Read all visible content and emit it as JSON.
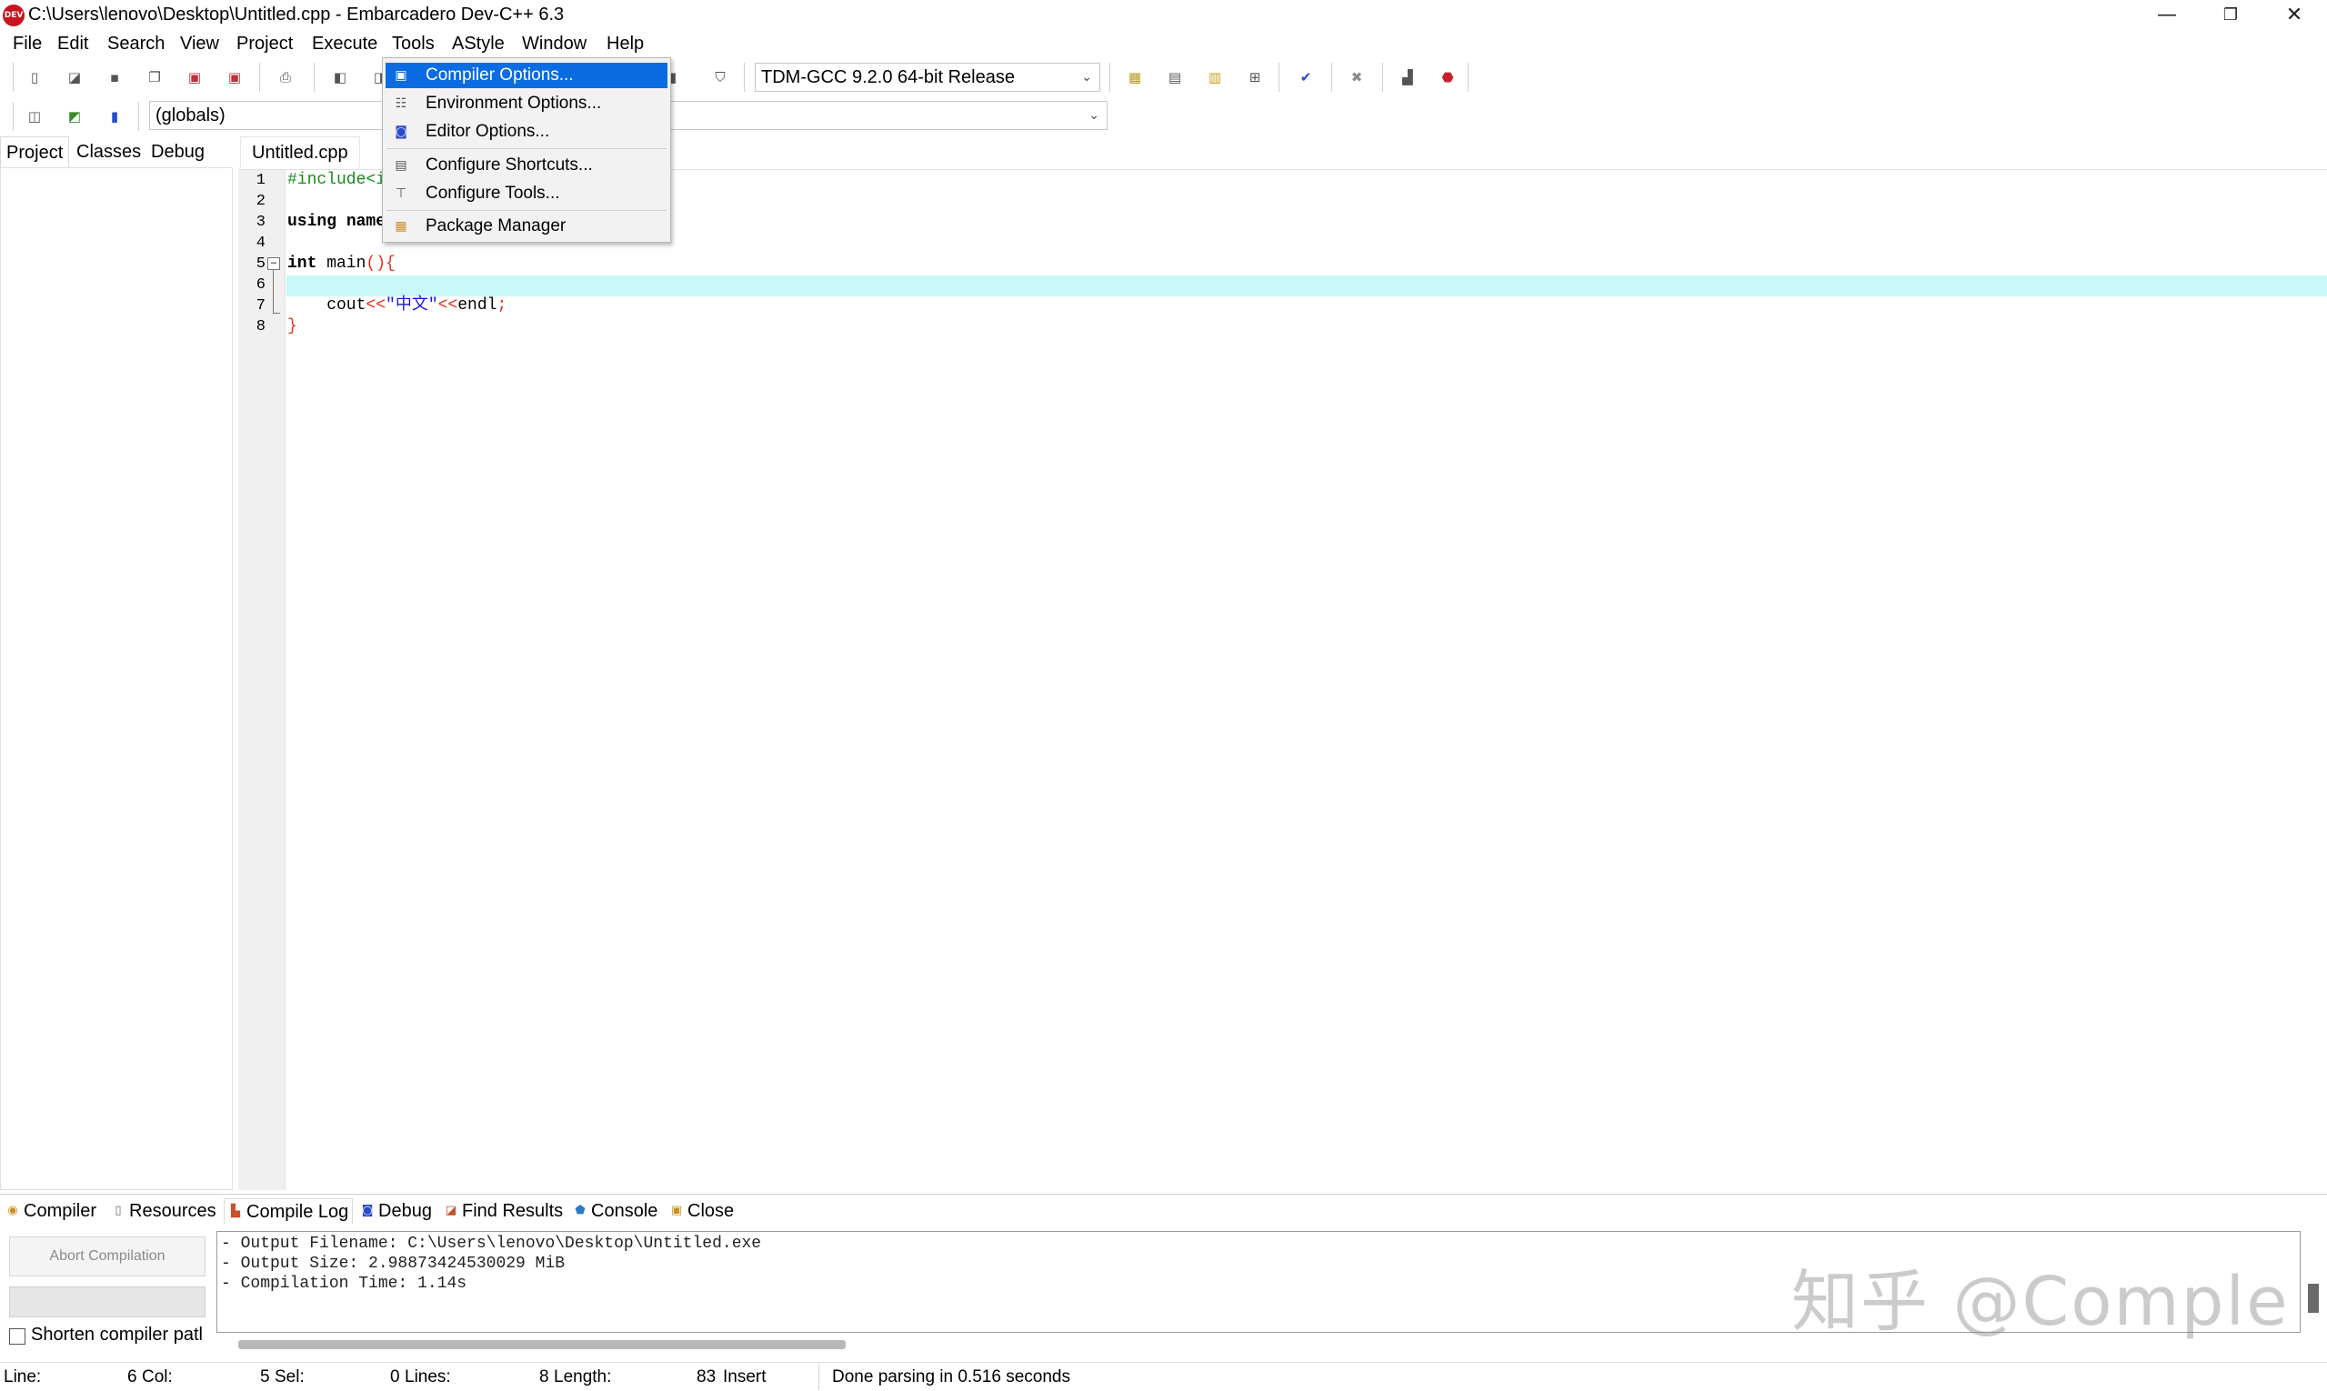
{
  "window": {
    "title": "C:\\Users\\lenovo\\Desktop\\Untitled.cpp - Embarcadero Dev-C++ 6.3",
    "app_icon_text": "DEV",
    "minimize": "—",
    "restore": "❐",
    "close": "✕"
  },
  "menu": {
    "items": [
      "File",
      "Edit",
      "Search",
      "View",
      "Project",
      "Execute",
      "Tools",
      "AStyle",
      "Window",
      "Help"
    ]
  },
  "tools_menu": {
    "items": [
      {
        "label": "Compiler Options...",
        "icon": "compiler-options-icon",
        "selected": true
      },
      {
        "label": "Environment Options...",
        "icon": "environment-options-icon"
      },
      {
        "label": "Editor Options...",
        "icon": "editor-options-icon"
      },
      {
        "label": "Configure Shortcuts...",
        "icon": "configure-shortcuts-icon"
      },
      {
        "label": "Configure Tools...",
        "icon": "configure-tools-icon"
      },
      {
        "label": "Package Manager",
        "icon": "package-manager-icon"
      }
    ]
  },
  "toolbar": {
    "compiler_select": "TDM-GCC 9.2.0 64-bit Release",
    "scope_select": "(globals)"
  },
  "left_panel": {
    "tabs": [
      "Project",
      "Classes",
      "Debug"
    ]
  },
  "editor": {
    "file_tab": "Untitled.cpp",
    "line_numbers": [
      "1",
      "2",
      "3",
      "4",
      "5",
      "6",
      "7",
      "8"
    ],
    "code": {
      "l1": "#include<i",
      "l3_kw": "using",
      "l3_rest": " name",
      "l5_kw": "int",
      "l5_name": " main",
      "l5_sym": "(){",
      "l7_indent": "    cout",
      "l7_op1": "<<",
      "l7_str": "\"中文\"",
      "l7_op2": "<<",
      "l7_endl": "endl",
      "l7_semi": ";",
      "l8": "}"
    },
    "current_line": 6
  },
  "bottom_panel": {
    "tabs": [
      {
        "label": "Compiler",
        "icon": "compiler-icon"
      },
      {
        "label": "Resources",
        "icon": "resources-icon"
      },
      {
        "label": "Compile Log",
        "icon": "compile-log-icon",
        "active": true
      },
      {
        "label": "Debug",
        "icon": "debug-icon"
      },
      {
        "label": "Find Results",
        "icon": "find-results-icon"
      },
      {
        "label": "Console",
        "icon": "console-icon"
      },
      {
        "label": "Close",
        "icon": "close-panel-icon"
      }
    ],
    "abort_label": "Abort Compilation",
    "shorten_label": "Shorten compiler patl",
    "log_lines": [
      "- Output Filename: C:\\Users\\lenovo\\Desktop\\Untitled.exe",
      "- Output Size: 2.98873424530029 MiB",
      "- Compilation Time: 1.14s"
    ],
    "watermark": "知乎 @Comple"
  },
  "status": {
    "line_label": "Line:",
    "line_value": "6",
    "col_label": "Col:",
    "col_value": "5",
    "sel_label": "Sel:",
    "sel_value": "0",
    "lines_label": "Lines:",
    "lines_value": "8",
    "length_label": "Length:",
    "length_value": "83",
    "mode": "Insert",
    "message": "Done parsing in 0.516 seconds"
  },
  "colors": {
    "selection": "#0a6ce0",
    "current_line": "#c8f8f8",
    "preprocessor": "#1b8a1b",
    "symbol": "#e0301e",
    "string": "#1a1ad0"
  }
}
